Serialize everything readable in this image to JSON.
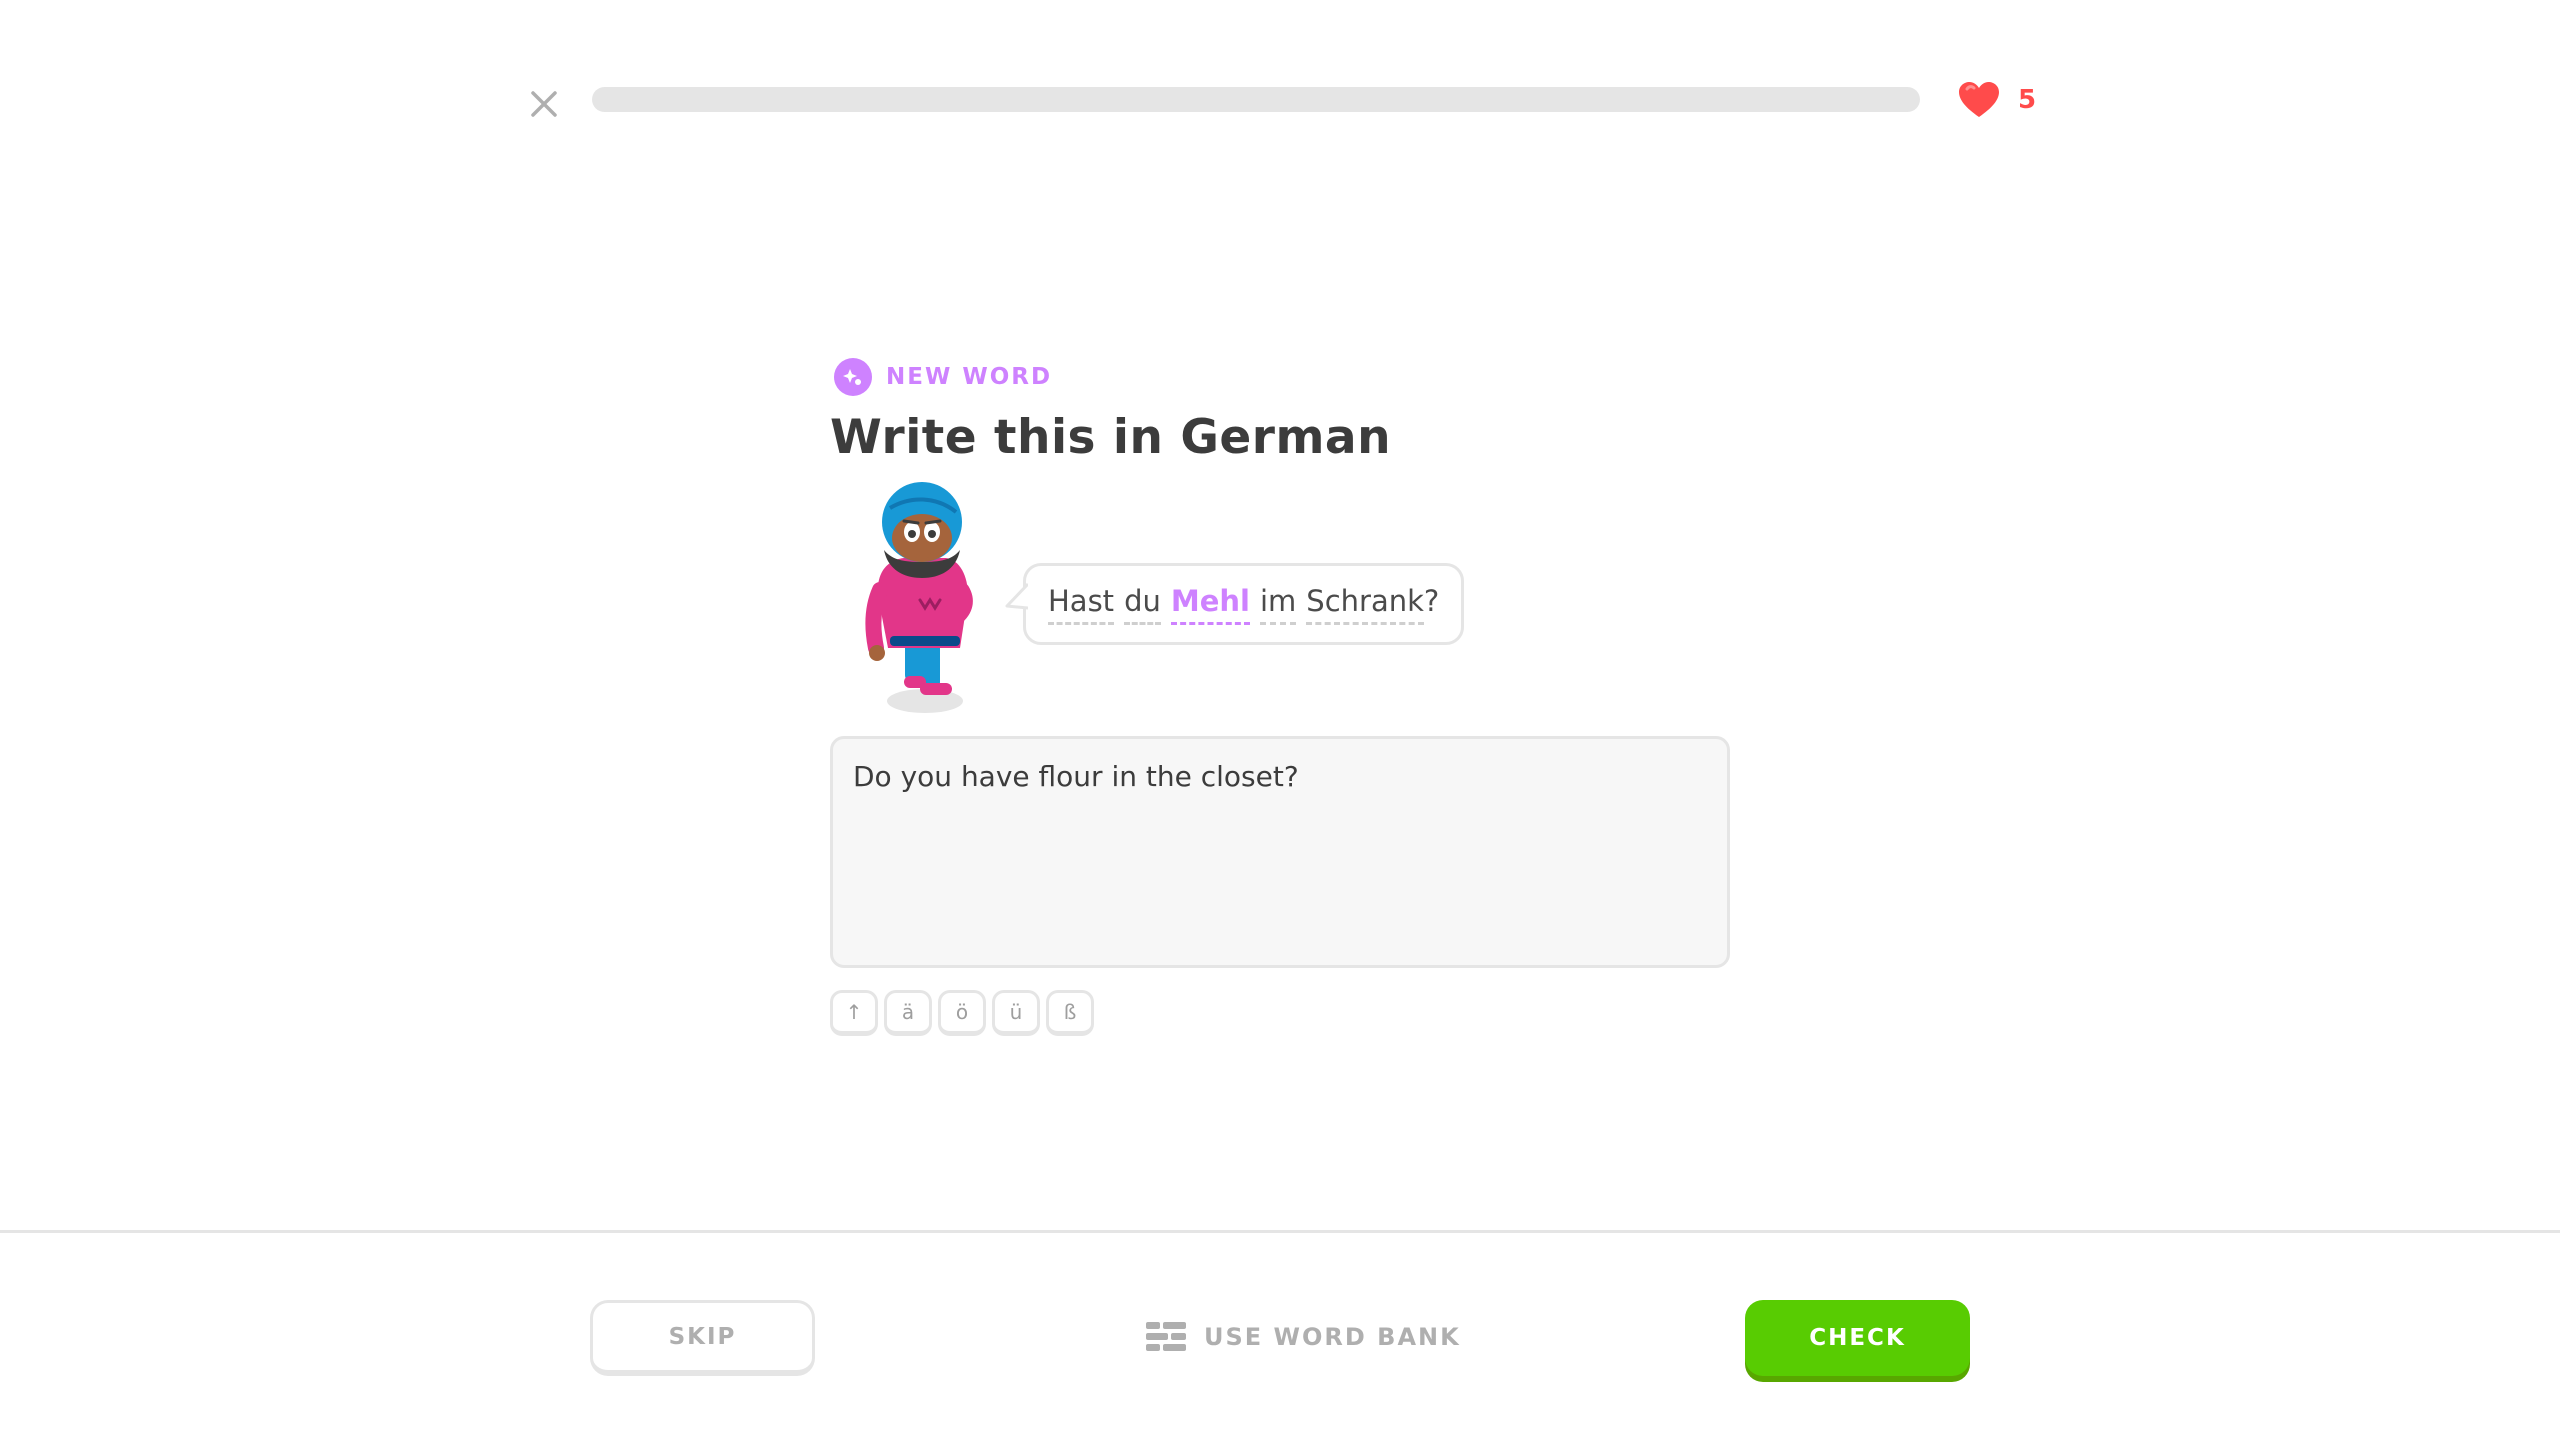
{
  "header": {
    "close_icon": "close-icon",
    "progress": 0,
    "hearts_icon": "heart-icon",
    "hearts_count": "5"
  },
  "prompt": {
    "badge_icon": "new-word-icon",
    "badge_label": "NEW WORD",
    "title": "Write this in German"
  },
  "bubble": {
    "words": [
      {
        "text": "Hast",
        "highlight": false
      },
      {
        "text": "du",
        "highlight": false
      },
      {
        "text": "Mehl",
        "highlight": true
      },
      {
        "text": "im",
        "highlight": false
      },
      {
        "text": "Schrank",
        "highlight": false
      },
      {
        "text": "?",
        "highlight": false
      }
    ]
  },
  "answer": {
    "value": "Do you have flour in the closet?"
  },
  "special_keys": [
    "↑",
    "ä",
    "ö",
    "ü",
    "ß"
  ],
  "footer": {
    "skip_label": "SKIP",
    "word_bank_icon": "word-bank-icon",
    "word_bank_label": "USE WORD BANK",
    "check_label": "CHECK"
  },
  "colors": {
    "accent_purple": "#ce82ff",
    "check_green": "#58cc02",
    "heart_red": "#ff4b4b"
  }
}
